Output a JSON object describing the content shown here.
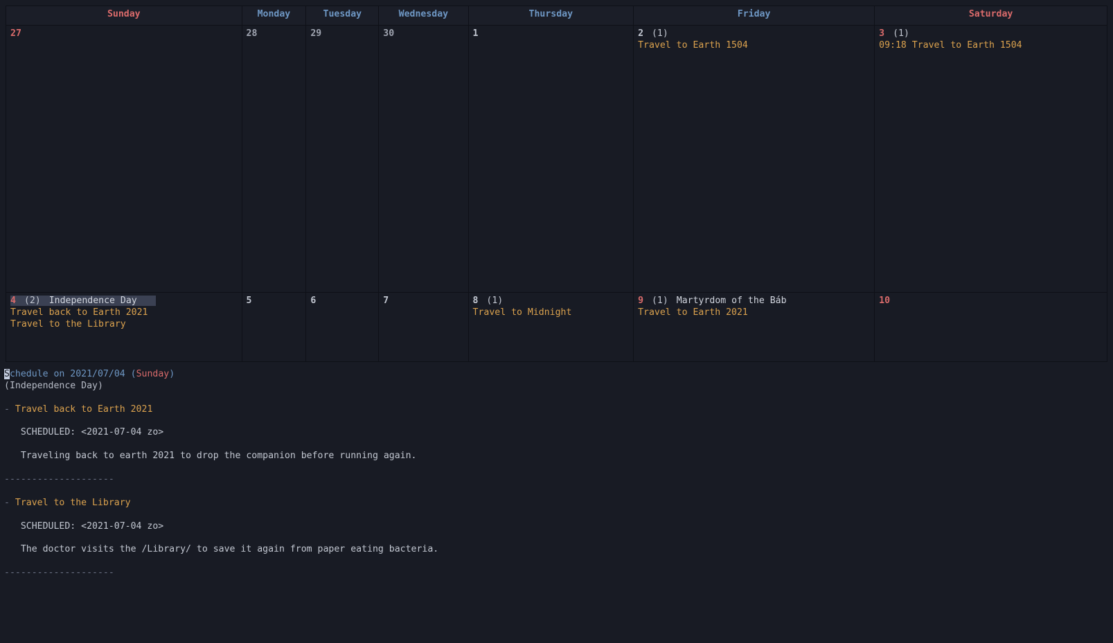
{
  "header": {
    "days": [
      "Sunday",
      "Monday",
      "Tuesday",
      "Wednesday",
      "Thursday",
      "Friday",
      "Saturday"
    ]
  },
  "row1": {
    "sun": {
      "num": "27"
    },
    "mon": {
      "num": "28"
    },
    "tue": {
      "num": "29"
    },
    "wed": {
      "num": "30"
    },
    "thu": {
      "num": "1"
    },
    "fri": {
      "num": "2",
      "count": "(1)",
      "entry1": "Travel to Earth 1504"
    },
    "sat": {
      "num": "3",
      "count": "(1)",
      "entry1": "09:18 Travel to Earth 1504"
    }
  },
  "row2": {
    "sun": {
      "num": "4",
      "count": "(2)",
      "holiday": "Independence Day",
      "entry1": "Travel back to Earth 2021",
      "entry2": "Travel to the Library"
    },
    "mon": {
      "num": "5"
    },
    "tue": {
      "num": "6"
    },
    "wed": {
      "num": "7"
    },
    "thu": {
      "num": "8",
      "count": "(1)",
      "entry1": "Travel to Midnight"
    },
    "fri": {
      "num": "9",
      "count": "(1)",
      "holiday": "Martyrdom of the Báb",
      "entry1": "Travel to Earth 2021"
    },
    "sat": {
      "num": "10"
    }
  },
  "schedule": {
    "prefix": "chedule on ",
    "date": "2021/07/04",
    "open": " (",
    "dayname": "Sunday",
    "close": ")",
    "holiday_line": "(Independence Day)",
    "item1": {
      "bullet": "- ",
      "title": "Travel back to Earth 2021",
      "sched_line": "   SCHEDULED: <2021-07-04 zo>",
      "body": "   Traveling back to earth 2021 to drop the companion before running again."
    },
    "sep": "--------------------",
    "item2": {
      "bullet": "- ",
      "title": "Travel to the Library",
      "sched_line": "   SCHEDULED: <2021-07-04 zo>",
      "body": "   The doctor visits the /Library/ to save it again from paper eating bacteria."
    }
  }
}
